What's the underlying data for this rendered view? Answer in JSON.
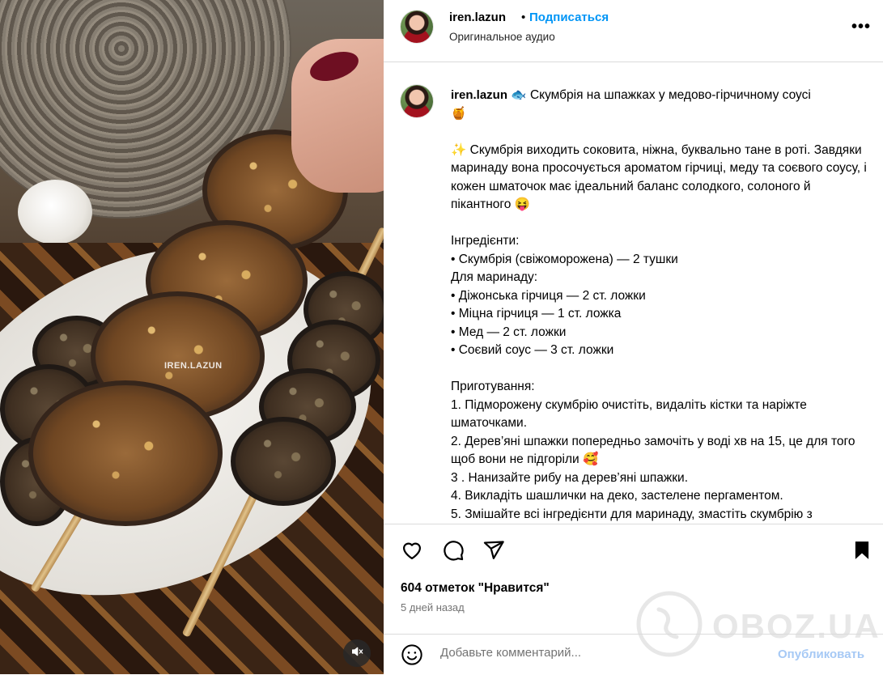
{
  "media": {
    "watermark": "IREN.LAZUN"
  },
  "header": {
    "username": "iren.lazun",
    "separator": "•",
    "follow_label": "Подписаться",
    "audio_label": "Оригинальное аудио",
    "more_icon": "more-options-icon",
    "more_label": "•••"
  },
  "caption": {
    "username": "iren.lazun",
    "title_emoji": "🐟",
    "title": "Скумбрія на шпажках у медово-гірчичному соусі",
    "title_end_emoji": "🍯",
    "intro_emoji": "✨",
    "intro": "Скумбрія виходить соковита, ніжна, буквально тане в роті. Завдяки маринаду вона просочується ароматом гірчиці, меду та соєвого соусу, і кожен шматочок має ідеальний баланс солодкого, солоного й пікантного",
    "intro_end_emoji": "😝",
    "ingredients_heading": "Інгредієнти:",
    "ingredients": [
      "• Скумбрія (свіжоморожена) — 2 тушки"
    ],
    "marinade_heading": "Для маринаду:",
    "marinade": [
      "• Діжонська гірчиця — 2 ст. ложки",
      "• Міцна гірчиця — 1 ст. ложка",
      "• Мед — 2 ст. ложки",
      "• Соєвий соус — 3 ст. ложки"
    ],
    "steps_heading": "Приготування:",
    "steps": [
      "1. Підморожену скумбрію очистіть, видаліть кістки та наріжте шматочками.",
      "2. Дерев’яні шпажки попередньо замочіть у воді хв на 15, це для того щоб вони не підгоріли 🥰",
      "3 . Нанизайте рибу на дерев’яні шпажки.",
      "4. Викладіть шашлички на деко, застелене пергаментом.",
      "5. Змішайте всі інгредієнти для маринаду, змастіть скумбрію з"
    ]
  },
  "actions": {
    "like_icon": "heart-icon",
    "comment_icon": "comment-icon",
    "share_icon": "share-icon",
    "save_icon": "bookmark-icon",
    "likes": "604 отметок \"Нравится\"",
    "time": "5 дней назад"
  },
  "watermark": {
    "text": "OBOZ.UA"
  },
  "comment": {
    "emoji_icon": "emoji-icon",
    "placeholder": "Добавьте комментарий...",
    "publish_label": "Опубликовать"
  },
  "colors": {
    "accent": "#0095f6",
    "publish_disabled": "#a6c9f5",
    "muted_text": "#737373",
    "divider": "#dbdbdb"
  }
}
